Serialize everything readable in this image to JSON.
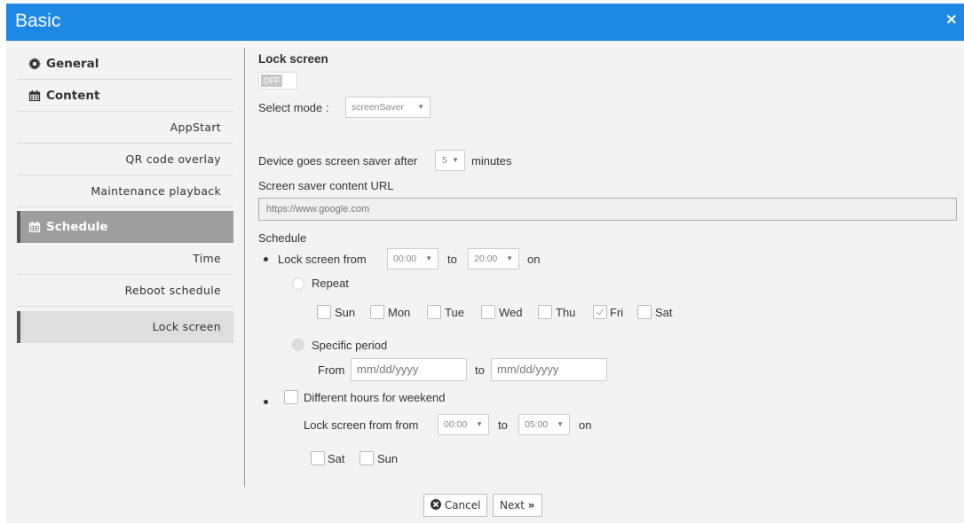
{
  "window": {
    "title": "Basic",
    "close_glyph": "×"
  },
  "sidebar": {
    "items": [
      {
        "label": "General",
        "icon": "gear-icon"
      },
      {
        "label": "Content",
        "icon": "calendar-icon"
      },
      {
        "label": "AppStart"
      },
      {
        "label": "QR code overlay"
      },
      {
        "label": "Maintenance playback"
      },
      {
        "label": "Schedule",
        "icon": "calendar-icon",
        "active": true
      },
      {
        "label": "Time"
      },
      {
        "label": "Reboot schedule"
      },
      {
        "label": "Lock screen",
        "active": true
      }
    ]
  },
  "lock_screen": {
    "title": "Lock screen",
    "toggle_state": "OFF",
    "select_mode_label": "Select mode :",
    "mode_value": "screenSaver",
    "saver_prefix": "Device goes screen saver after",
    "saver_minutes": "5",
    "saver_suffix": "minutes",
    "url_label": "Screen saver content URL",
    "url_value": "https://www.google.com"
  },
  "schedule": {
    "title": "Schedule",
    "lock_from_label": "Lock screen from",
    "from_time": "00:00",
    "to_label": "to",
    "to_time": "20:00",
    "on_label": "on",
    "repeat_label": "Repeat",
    "days": [
      {
        "label": "Sun",
        "checked": false
      },
      {
        "label": "Mon",
        "checked": false
      },
      {
        "label": "Tue",
        "checked": false
      },
      {
        "label": "Wed",
        "checked": false
      },
      {
        "label": "Thu",
        "checked": false
      },
      {
        "label": "Fri",
        "checked": true
      },
      {
        "label": "Sat",
        "checked": false
      }
    ],
    "specific_period_label": "Specific period",
    "from_label": "From",
    "date_from_placeholder": "mm/dd/yyyy",
    "date_to_label": "to",
    "date_to_placeholder": "mm/dd/yyyy",
    "weekend_label": "Different hours for weekend",
    "weekend_lock_label": "Lock screen from from",
    "weekend_from_time": "00:00",
    "weekend_to_label": "to",
    "weekend_to_time": "05:00",
    "weekend_on_label": "on",
    "weekend_days": [
      {
        "label": "Sat",
        "checked": false
      },
      {
        "label": "Sun",
        "checked": false
      }
    ]
  },
  "footer": {
    "cancel_label": "Cancel",
    "next_label": "Next"
  },
  "colors": {
    "titlebar": "#1e88e5",
    "active_item": "#9e9e9e",
    "active_sub": "#dedede"
  }
}
